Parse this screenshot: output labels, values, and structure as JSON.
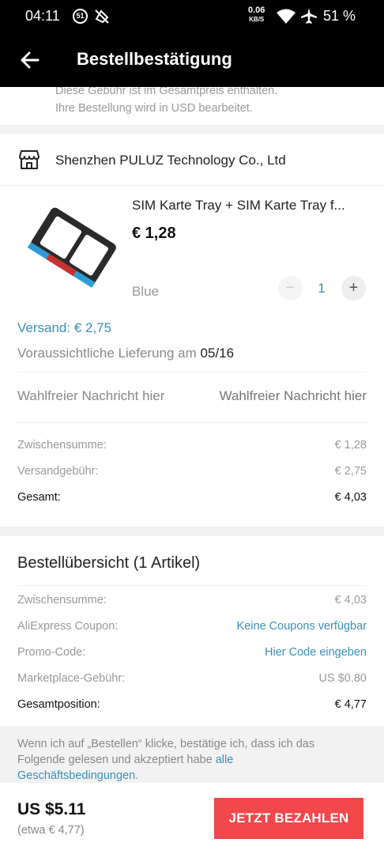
{
  "status_bar": {
    "time": "04:11",
    "notification_badge": "51",
    "net_speed": "0.06",
    "net_speed_unit": "KB/S",
    "battery": "51 %"
  },
  "app_bar": {
    "back_icon": "arrow-left-icon",
    "title": "Bestellbestätigung"
  },
  "notice": {
    "line1": "Diese Gebühr ist im Gesamtpreis enthalten.",
    "line2": "Ihre Bestellung wird in USD bearbeitet."
  },
  "store": {
    "icon": "store-icon",
    "name": "Shenzhen PULUZ Technology Co., Ltd"
  },
  "product": {
    "title": "SIM Karte Tray + SIM Karte Tray f...",
    "price": "€ 1,28",
    "variant": "Blue",
    "quantity": "1",
    "minus": "−",
    "plus": "+",
    "shipping": "Versand: € 2,75",
    "delivery_label": "Voraussichtliche Lieferung am",
    "delivery_date": "05/16",
    "message_label": "Wahlfreier Nachricht hier",
    "message_placeholder": "Wahlfreier Nachricht hier"
  },
  "store_totals": [
    {
      "label": "Zwischensumme:",
      "value": "€ 1,28"
    },
    {
      "label": "Versandgebühr:",
      "value": "€ 2,75"
    },
    {
      "label": "Gesamt:",
      "value": "€ 4,03"
    }
  ],
  "summary": {
    "title": "Bestellübersicht (1 Artikel)",
    "rows": [
      {
        "label": "Zwischensumme:",
        "value": "€ 4,03"
      },
      {
        "label": "AliExpress Coupon:",
        "value": "Keine Coupons verfügbar"
      },
      {
        "label": "Promo-Code:",
        "value": "Hier Code eingeben"
      },
      {
        "label": "Marketplace-Gebühr:",
        "value": "US $0.80"
      },
      {
        "label": "Gesamtposition:",
        "value": "€ 4,77"
      }
    ]
  },
  "terms": {
    "text": "Wenn ich auf „Bestellen“ klicke, bestätige ich, dass ich das Folgende gelesen und akzeptiert habe",
    "link": "alle Geschäftsbedingungen",
    "end": "."
  },
  "footer": {
    "total_usd": "US $5.11",
    "total_eur": "(etwa € 4,77)",
    "pay_button": "JETZT BEZAHLEN"
  },
  "colors": {
    "accent_link": "#3a8fb7",
    "pay_button": "#f2474b",
    "header_bg": "#000000"
  }
}
